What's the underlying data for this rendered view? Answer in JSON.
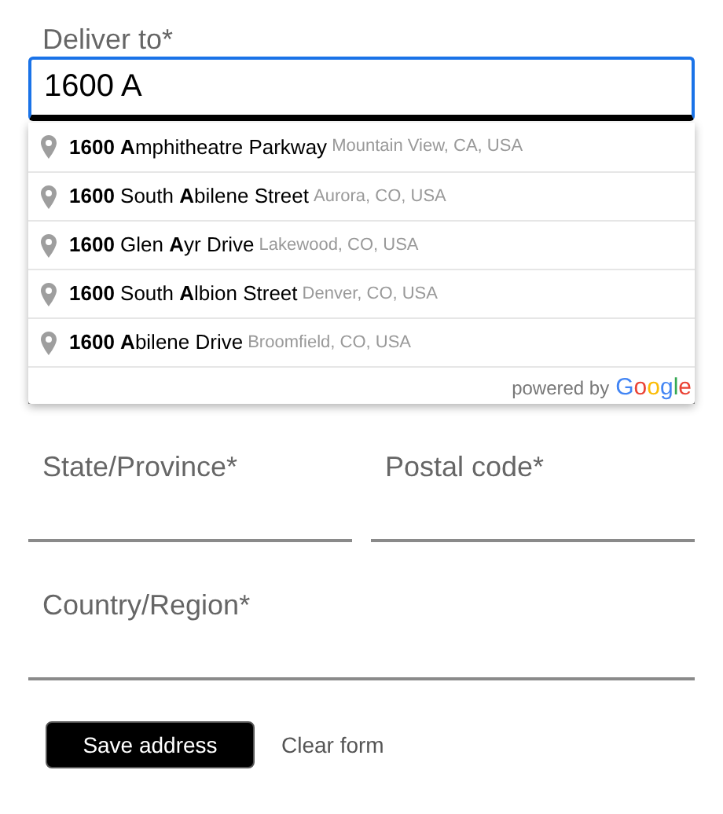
{
  "deliver_to": {
    "label": "Deliver to*",
    "value": "1600 A",
    "focused": true
  },
  "suggestions": [
    {
      "main": "**1600** **A**mphitheatre Parkway",
      "secondary": "Mountain View, CA, USA"
    },
    {
      "main": "**1600** South **A**bilene Street",
      "secondary": "Aurora, CO, USA"
    },
    {
      "main": "**1600** Glen **A**yr Drive",
      "secondary": "Lakewood, CO, USA"
    },
    {
      "main": "**1600** South **A**lbion Street",
      "secondary": "Denver, CO, USA"
    },
    {
      "main": "**1600** **A**bilene Drive",
      "secondary": "Broomfield, CO, USA"
    }
  ],
  "attribution": {
    "text": "powered by",
    "logo": "Google"
  },
  "fields": [
    {
      "label": "State/Province*"
    },
    {
      "label": "Postal code*"
    }
  ],
  "country": {
    "label": "Country/Region*"
  },
  "buttons": [
    {
      "kind": "primary",
      "label": "Save address"
    },
    {
      "kind": "link",
      "label": "Clear form"
    }
  ]
}
